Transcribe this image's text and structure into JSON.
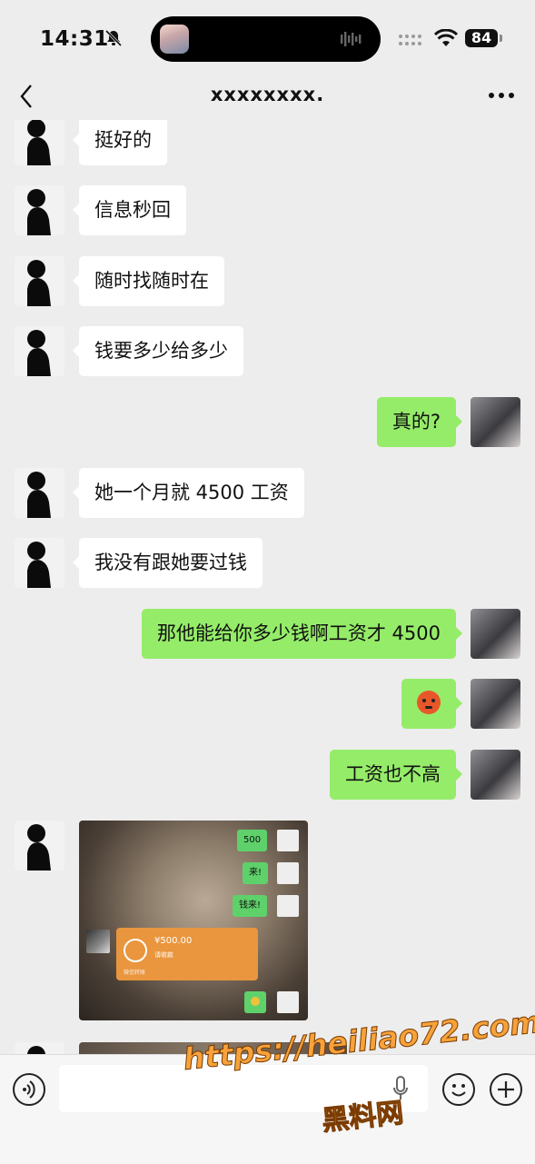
{
  "status_bar": {
    "time": "14:31",
    "battery": "84"
  },
  "nav": {
    "title": "xxxxxxxx.",
    "back_icon": "chevron-left-icon",
    "more_icon": "more-dots-icon"
  },
  "messages": [
    {
      "side": "left",
      "text": "挺好的"
    },
    {
      "side": "left",
      "text": "信息秒回"
    },
    {
      "side": "left",
      "text": "随时找随时在"
    },
    {
      "side": "left",
      "text": "钱要多少给多少"
    },
    {
      "side": "right",
      "text": "真的?"
    },
    {
      "side": "left",
      "text": "她一个月就 4500 工资"
    },
    {
      "side": "left",
      "text": "我没有跟她要过钱"
    },
    {
      "side": "right",
      "text": "那他能给你多少钱啊工资才 4500"
    },
    {
      "side": "right",
      "type": "emoji",
      "emoji": "angry-face-emoji"
    },
    {
      "side": "right",
      "text": "工资也不高"
    },
    {
      "side": "left",
      "type": "image"
    },
    {
      "side": "left",
      "type": "image"
    }
  ],
  "screenshot": {
    "bubbles": [
      "500",
      "来!",
      "钱来!"
    ],
    "transfer": {
      "amount": "¥500.00",
      "status": "请收款",
      "footer": "微信转账"
    }
  },
  "input_bar": {
    "voice_icon": "voice-icon",
    "emoji_icon": "emoji-icon",
    "plus_icon": "plus-icon"
  },
  "watermark": {
    "url": "https://heiliao72.com",
    "name": "黑料网"
  },
  "colors": {
    "background": "#ededed",
    "outgoing_bubble": "#95ec69",
    "incoming_bubble": "#ffffff",
    "watermark": "#f7a23a"
  }
}
